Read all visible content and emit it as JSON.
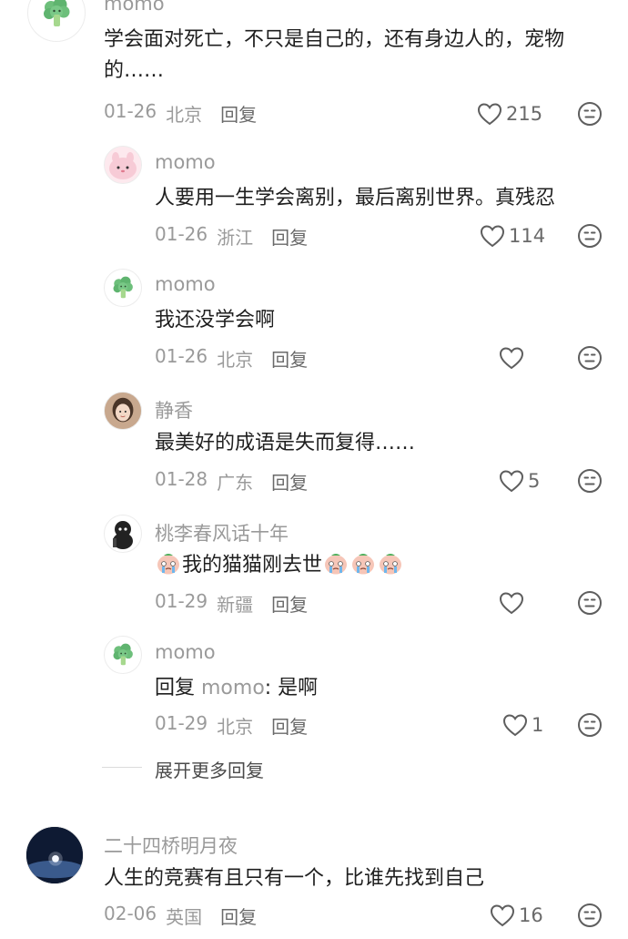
{
  "comments": [
    {
      "username": "momo",
      "text": "学会面对死亡，不只是自己的，还有身边人的，宠物的……",
      "date": "01-26",
      "location": "北京",
      "reply_label": "回复",
      "likes": "215"
    },
    {
      "username": "momo",
      "text": "人要用一生学会离别，最后离别世界。真残忍",
      "date": "01-26",
      "location": "浙江",
      "reply_label": "回复",
      "likes": "114"
    },
    {
      "username": "momo",
      "text": "我还没学会啊",
      "date": "01-26",
      "location": "北京",
      "reply_label": "回复",
      "likes": ""
    },
    {
      "username": "静香",
      "text": "最美好的成语是失而复得……",
      "date": "01-28",
      "location": "广东",
      "reply_label": "回复",
      "likes": "5"
    },
    {
      "username": "桃李春风话十年",
      "text": "我的猫猫刚去世",
      "date": "01-29",
      "location": "新疆",
      "reply_label": "回复",
      "likes": ""
    },
    {
      "username": "momo",
      "reply_prefix": "回复 ",
      "reply_target": "momo",
      "text": ": 是啊",
      "date": "01-29",
      "location": "北京",
      "reply_label": "回复",
      "likes": "1"
    },
    {
      "username": "二十四桥明月夜",
      "text": "人生的竞赛有且只有一个，比谁先找到自己",
      "date": "02-06",
      "location": "英国",
      "reply_label": "回复",
      "likes": "16"
    }
  ],
  "expand_replies_label": "展开更多回复",
  "icons": {
    "like": "heart-outline-icon",
    "dislike": "unhappy-face-icon",
    "crying_emoji": "crying-face-emoji"
  },
  "colors": {
    "text": "#1f1f1f",
    "secondary": "#9a9a9a",
    "icon": "#6a6a6a"
  }
}
